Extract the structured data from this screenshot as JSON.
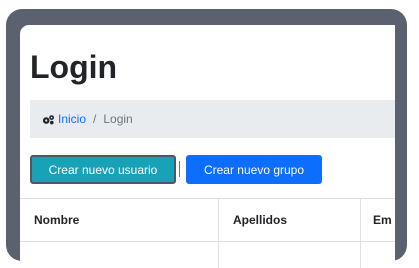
{
  "page": {
    "title": "Login"
  },
  "breadcrumb": {
    "home_icon": "gears-icon",
    "home_label": "Inicio",
    "separator": "/",
    "current_label": "Login"
  },
  "actions": {
    "create_user_label": "Crear nuevo usuario",
    "divider": "|",
    "create_group_label": "Crear nuevo grupo"
  },
  "table": {
    "columns": [
      "Nombre",
      "Apellidos",
      "Em"
    ]
  },
  "colors": {
    "teal_button": "#17a2b8",
    "blue_button": "#0d6efd",
    "link": "#0d6efd",
    "frame": "#5c6170"
  }
}
